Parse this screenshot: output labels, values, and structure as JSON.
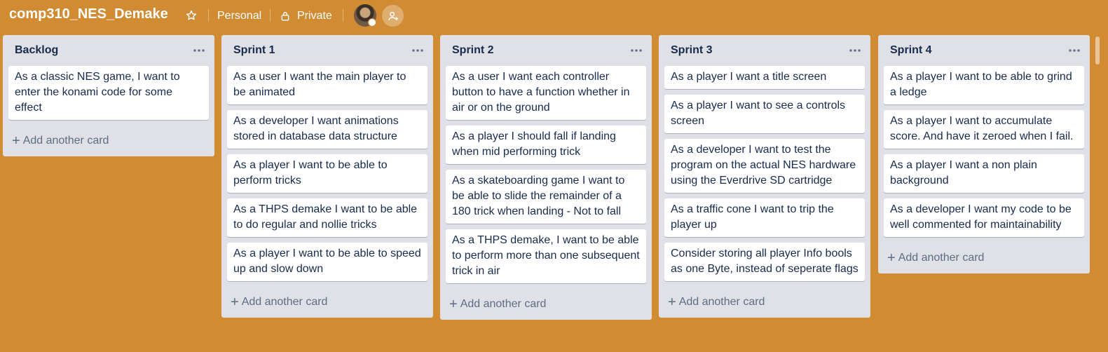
{
  "board": {
    "title": "comp310_NES_Demake",
    "team": "Personal",
    "visibility": "Private"
  },
  "lists": [
    {
      "title": "Backlog",
      "cards": [
        "As a classic NES game, I want to enter the konami code for some effect"
      ],
      "add_label": "Add another card"
    },
    {
      "title": "Sprint 1",
      "cards": [
        "As a user I want the main player to be animated",
        "As a developer I want animations stored in database data structure",
        "As a player I want to be able to perform tricks",
        "As a THPS demake I want to be able to do regular and nollie tricks",
        "As a player I want to be able to speed up and slow down"
      ],
      "add_label": "Add another card"
    },
    {
      "title": "Sprint 2",
      "cards": [
        "As a user I want each controller button to have a function whether in air or on the ground",
        "As a player I should fall if landing when mid performing trick",
        "As a skateboarding game I want to be able to slide the remainder of a 180 trick when landing - Not to fall",
        "As a THPS demake, I want to be able to perform more than one subsequent trick in air"
      ],
      "add_label": "Add another card"
    },
    {
      "title": "Sprint 3",
      "cards": [
        "As a player I want a title screen",
        "As a player I want to see a controls screen",
        "As a developer I want to test the program on the actual NES hardware using the Everdrive SD cartridge",
        "As a traffic cone I want to trip the player up",
        "Consider storing all player Info bools as one Byte, instead of seperate flags"
      ],
      "add_label": "Add another card"
    },
    {
      "title": "Sprint 4",
      "cards": [
        "As a player I want to be able to grind a ledge",
        "As a player I want to accumulate score. And have it zeroed when I fail.",
        "As a player I want a non plain background",
        "As a developer I want my code to be well commented for maintainability"
      ],
      "add_label": "Add another card"
    }
  ],
  "icons": {
    "star": "star-icon",
    "lock": "lock-icon",
    "invite": "add-member-icon",
    "menu": "more-icon"
  },
  "colors": {
    "board_background": "#d18b32",
    "list_background": "#dfe1e6",
    "card_background": "#ffffff",
    "text_primary": "#172b4d",
    "text_muted": "#5e6c84"
  }
}
